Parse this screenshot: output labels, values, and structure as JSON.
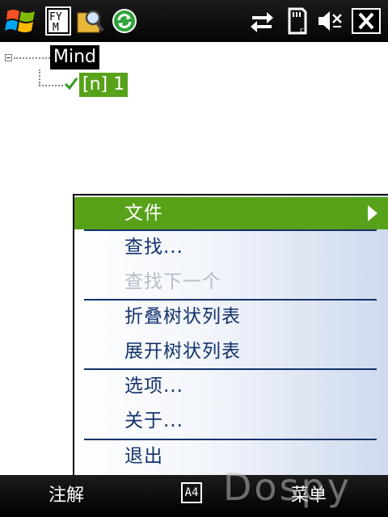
{
  "status_bar": {
    "start_icon": "windows-flag-icon",
    "fym_label": "FY M",
    "icons": [
      "windows-flag-icon",
      "fym-app-icon",
      "search-app-icon",
      "sync-icon",
      "connectivity-icon",
      "sd-card-icon",
      "speaker-muted-icon",
      "close-icon"
    ]
  },
  "tree": {
    "root_label": "Mind",
    "child_label": "[n] 1"
  },
  "context_menu": {
    "items": [
      {
        "label": "文件",
        "state": "highlighted",
        "has_submenu": true
      },
      {
        "label": "查找...",
        "state": "enabled"
      },
      {
        "label": "查找下一个",
        "state": "disabled"
      },
      {
        "label": "折叠树状列表",
        "state": "enabled"
      },
      {
        "label": "展开树状列表",
        "state": "enabled"
      },
      {
        "label": "选项...",
        "state": "enabled"
      },
      {
        "label": "关于...",
        "state": "enabled"
      },
      {
        "label": "退出",
        "state": "enabled"
      }
    ]
  },
  "soft_keys": {
    "left": "注解",
    "sip_label": "A4",
    "right": "菜单"
  },
  "watermark": "Dospy",
  "colors": {
    "highlight": "#58a21a",
    "menu_text": "#13336b",
    "disabled_text": "#b5bcc9",
    "bar_background": "#000000"
  }
}
